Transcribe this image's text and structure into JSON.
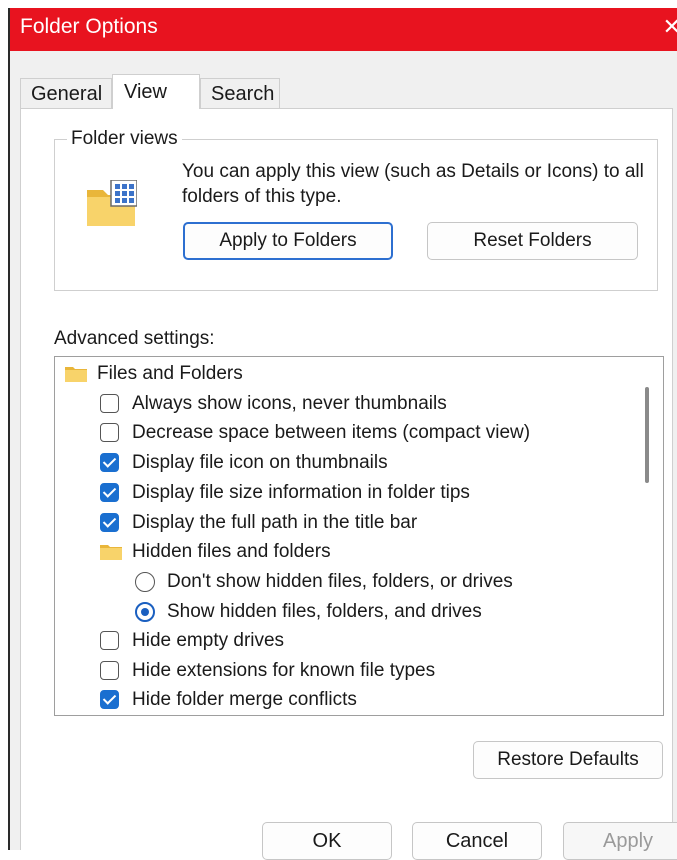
{
  "window": {
    "title": "Folder Options",
    "close_glyph": "✕"
  },
  "tabs": [
    {
      "label": "General",
      "active": false
    },
    {
      "label": "View",
      "active": true
    },
    {
      "label": "Search",
      "active": false
    }
  ],
  "folder_views": {
    "group_label": "Folder views",
    "description": "You can apply this view (such as Details or Icons) to all folders of this type.",
    "apply_button": "Apply to Folders",
    "reset_button": "Reset Folders"
  },
  "advanced": {
    "label": "Advanced settings:",
    "items": [
      {
        "type": "folder",
        "label": "Files and Folders",
        "level": 0
      },
      {
        "type": "checkbox",
        "label": "Always show icons, never thumbnails",
        "checked": false,
        "level": 1
      },
      {
        "type": "checkbox",
        "label": "Decrease space between items (compact view)",
        "checked": false,
        "level": 1
      },
      {
        "type": "checkbox",
        "label": "Display file icon on thumbnails",
        "checked": true,
        "level": 1
      },
      {
        "type": "checkbox",
        "label": "Display file size information in folder tips",
        "checked": true,
        "level": 1
      },
      {
        "type": "checkbox",
        "label": "Display the full path in the title bar",
        "checked": true,
        "level": 1
      },
      {
        "type": "folder",
        "label": "Hidden files and folders",
        "level": 1
      },
      {
        "type": "radio",
        "label": "Don't show hidden files, folders, or drives",
        "checked": false,
        "level": 2
      },
      {
        "type": "radio",
        "label": "Show hidden files, folders, and drives",
        "checked": true,
        "level": 2
      },
      {
        "type": "checkbox",
        "label": "Hide empty drives",
        "checked": false,
        "level": 1
      },
      {
        "type": "checkbox",
        "label": "Hide extensions for known file types",
        "checked": false,
        "level": 1
      },
      {
        "type": "checkbox",
        "label": "Hide folder merge conflicts",
        "checked": true,
        "level": 1
      }
    ]
  },
  "restore_button": "Restore Defaults",
  "footer": {
    "ok": "OK",
    "cancel": "Cancel",
    "apply": "Apply"
  },
  "colors": {
    "titlebar": "#e8131f",
    "accent": "#1a6fd0",
    "folder": "#f6c94e"
  }
}
